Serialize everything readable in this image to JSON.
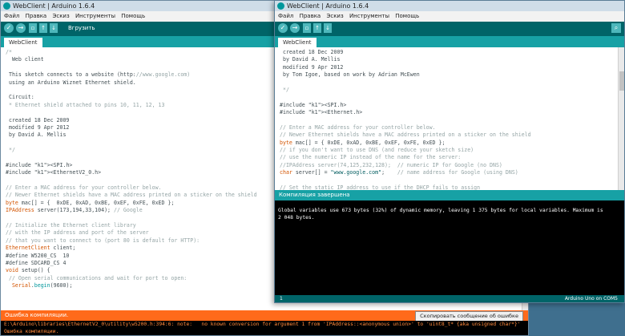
{
  "colors": {
    "toolbar": "#006468",
    "tabbar": "#17a1a5",
    "accent": "#00979c",
    "console_bg": "#000000",
    "error_text": "#ff8a3d"
  },
  "icons": [
    "verify-icon",
    "upload-icon",
    "new-icon",
    "open-icon",
    "save-icon",
    "serial-monitor-icon"
  ],
  "menu": [
    "Файл",
    "Правка",
    "Эскиз",
    "Инструменты",
    "Помощь"
  ],
  "back_window": {
    "title": "WebClient | Arduino 1.6.4",
    "toolbar_label": "Вгрузить",
    "tab": "WebClient",
    "code": [
      "/*",
      "  Web client",
      "",
      " This sketch connects to a website (http://www.google.com)",
      " using an Arduino Wiznet Ethernet shield.",
      "",
      " Circuit:",
      " * Ethernet shield attached to pins 10, 11, 12, 13",
      "",
      " created 18 Dec 2009",
      " modified 9 Apr 2012",
      " by David A. Mellis",
      "",
      " */",
      "",
      "#include <SPI.h>",
      "#include <EthernetV2_0.h>",
      "",
      "// Enter a MAC address for your controller below.",
      "// Newer Ethernet shields have a MAC address printed on a sticker on the shield",
      "byte mac[] = {  0xDE, 0xAD, 0xBE, 0xEF, 0xFE, 0xED };",
      "IPAddress server(173,194,33,104); // Google",
      "",
      "// Initialize the Ethernet client library",
      "// with the IP address and port of the server",
      "// that you want to connect to (port 80 is default for HTTP):",
      "EthernetClient client;",
      "#define W5200_CS  10",
      "#define SDCARD_CS 4",
      "void setup() {",
      " // Open serial communications and wait for port to open:",
      "  Serial.begin(9600);"
    ],
    "status": "Ошибка компиляции.",
    "copy_button": "Скопировать сообщение об ошибке",
    "console": [
      "E:\\Arduino\\libraries\\EthernetV2_0\\utility\\w5200.h:394:6: note:   no known conversion for argument 1 from 'IPAddress::<anonymous union>' to 'uint8_t* {aka unsigned char*}'",
      "Ошибка компиляции."
    ]
  },
  "front_window": {
    "title": "WebClient | Arduino 1.6.4",
    "tab": "WebClient",
    "code": [
      " created 18 Dec 2009",
      " by David A. Mellis",
      " modified 9 Apr 2012",
      " by Tom Igoe, based on work by Adrian McEwen",
      "",
      " */",
      "",
      "#include <SPI.h>",
      "#include <Ethernet.h>",
      "",
      "// Enter a MAC address for your controller below.",
      "// Newer Ethernet shields have a MAC address printed on a sticker on the shield",
      "byte mac[] = { 0xDE, 0xAD, 0xBE, 0xEF, 0xFE, 0xED };",
      "// if you don't want to use DNS (and reduce your sketch size)",
      "// use the numeric IP instead of the name for the server:",
      "//IPAddress server(74,125,232,128);  // numeric IP for Google (no DNS)",
      "char server[] = \"www.google.com\";    // name address for Google (using DNS)",
      "",
      "// Set the static IP address to use if the DHCP fails to assign"
    ],
    "status": "Компиляция завершена",
    "console": [
      "Global variables use 673 bytes (32%) of dynamic memory, leaving 1 375 bytes for local variables. Maximum is",
      "2 048 bytes."
    ],
    "line_number": "1",
    "board": "Arduino Uno on COM5"
  }
}
